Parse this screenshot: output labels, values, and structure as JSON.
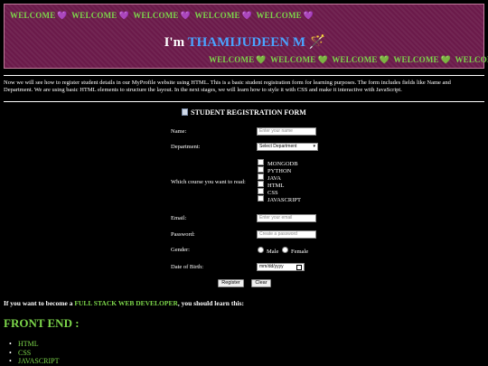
{
  "banner": {
    "welcome_word": "WELCOME",
    "greeting_prefix": "I'm",
    "name": "THAMIJUDEEN M",
    "wand": "🪄"
  },
  "intro": "Now we will see how to register student details in our MyProfile website using HTML. This is a basic student registration form for learning purposes. The form includes fields like Name and Department. We are using basic HTML elements to structure the layout. In the next stages, we will learn how to style it with CSS and make it interactive with JavaScript.",
  "form": {
    "title": "STUDENT REGISTRATION FORM",
    "name_label": "Name:",
    "name_placeholder": "Enter your name",
    "dept_label": "Department:",
    "dept_selected": "Select Department",
    "course_label": "Which course you want to read:",
    "courses": [
      "MONGODB",
      "PYTHON",
      "JAVA",
      "HTML",
      "CSS",
      "JAVASCRIPT"
    ],
    "email_label": "Email:",
    "email_placeholder": "Enter your email",
    "password_label": "Password:",
    "password_placeholder": "Create a password",
    "gender_label": "Gender:",
    "gender_options": [
      "Male",
      "Female"
    ],
    "dob_label": "Date of Birth:",
    "dob_placeholder": "mm/dd/yyyy",
    "register_label": "Register",
    "clear_label": "Clear"
  },
  "cta": {
    "prefix": "If you want to become a",
    "highlight": "FULL STACK WEB DEVELOPER",
    "suffix": ", you should learn this:"
  },
  "frontend": {
    "heading": "FRONT END :",
    "items": [
      "HTML",
      "CSS",
      "JAVASCRIPT"
    ]
  },
  "colors": {
    "banner_bg": "#6b1a4a",
    "accent_green": "#7cd64a",
    "name_blue": "#4aa3ff",
    "heart_purple": "#b05ad8"
  }
}
